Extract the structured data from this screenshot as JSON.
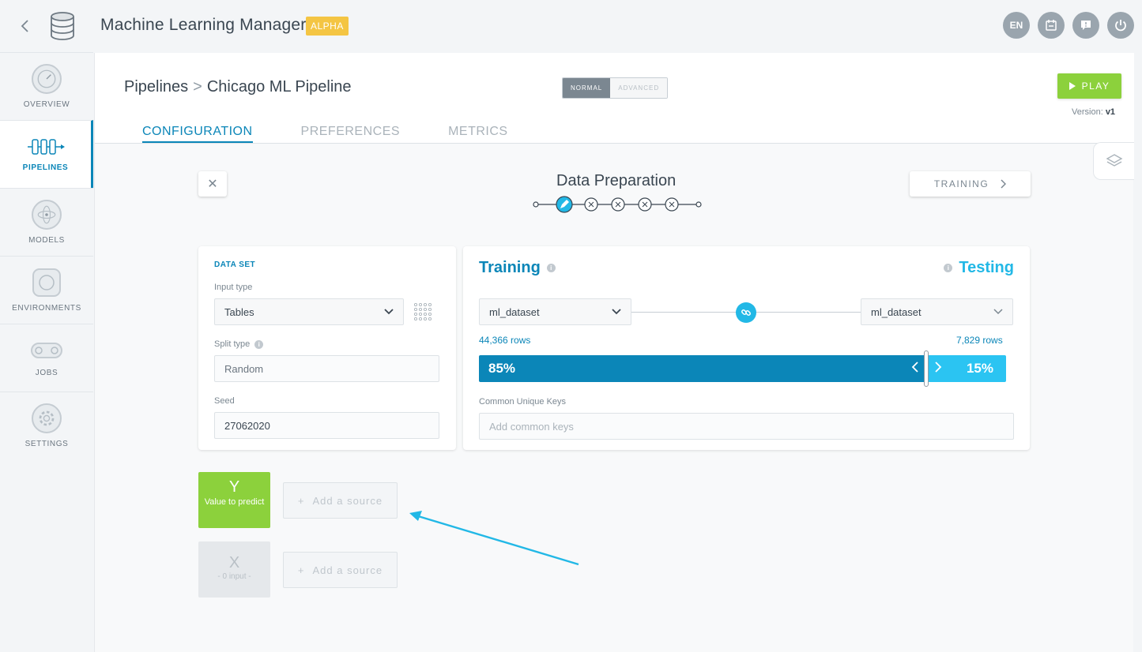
{
  "app": {
    "title": "Machine Learning Manager",
    "badge": "ALPHA"
  },
  "top_icons": {
    "lang": "EN"
  },
  "sidebar": {
    "items": [
      {
        "label": "OVERVIEW"
      },
      {
        "label": "PIPELINES"
      },
      {
        "label": "MODELS"
      },
      {
        "label": "ENVIRONMENTS"
      },
      {
        "label": "JOBS"
      },
      {
        "label": "SETTINGS"
      }
    ]
  },
  "header": {
    "breadcrumb_root": "Pipelines",
    "breadcrumb_sep": ">",
    "breadcrumb_current": "Chicago ML Pipeline",
    "mode_normal": "NORMAL",
    "mode_advanced": "ADVANCED",
    "play_label": "PLAY",
    "version_label": "Version:",
    "version_value": "v1"
  },
  "tabs": [
    {
      "label": "CONFIGURATION"
    },
    {
      "label": "PREFERENCES"
    },
    {
      "label": "METRICS"
    }
  ],
  "step": {
    "close": "✕",
    "title": "Data Preparation",
    "next_label": "TRAINING"
  },
  "dataset": {
    "title": "DATA SET",
    "input_type_label": "Input type",
    "input_type_value": "Tables",
    "split_type_label": "Split type",
    "split_type_value": "Random",
    "seed_label": "Seed",
    "seed_value": "27062020"
  },
  "split": {
    "training_title": "Training",
    "testing_title": "Testing",
    "training_dataset": "ml_dataset",
    "testing_dataset": "ml_dataset",
    "training_rows": "44,366 rows",
    "testing_rows": "7,829 rows",
    "training_pct": "85%",
    "testing_pct": "15%",
    "training_fraction": 0.85,
    "keys_label": "Common Unique Keys",
    "keys_placeholder": "Add common keys"
  },
  "sources": {
    "y_letter": "Y",
    "y_caption": "Value to predict",
    "x_letter": "X",
    "x_caption": "- 0 input -",
    "add_source_label": "Add a source",
    "add_plus": "+"
  },
  "colors": {
    "accent": "#0b86b8",
    "testing": "#22b8e6",
    "play": "#8cd13c",
    "badge": "#f4c543"
  }
}
